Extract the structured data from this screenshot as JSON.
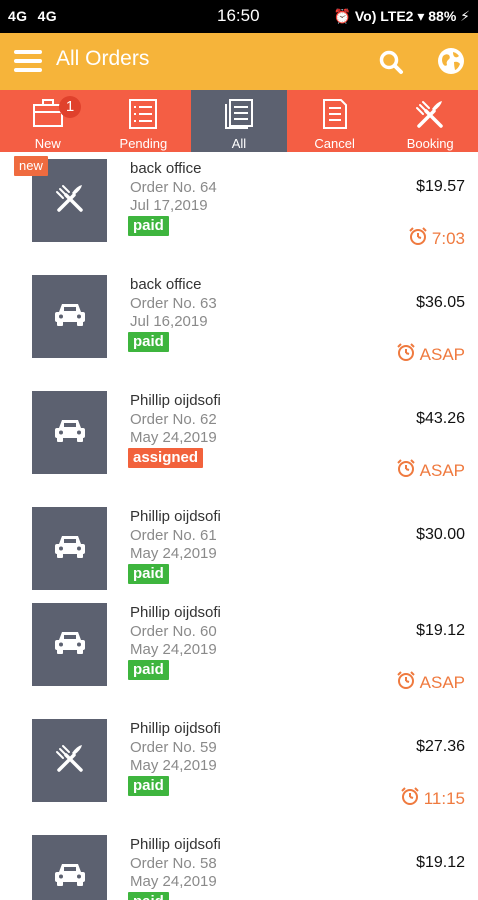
{
  "statusbar": {
    "left": "4G   4G ",
    "time": "16:50",
    "right": "⏰ Vo) LTE2 ▾ 88% ⚡"
  },
  "appbar": {
    "title": "All Orders"
  },
  "tabs": [
    {
      "label": "New",
      "badge": "1",
      "active": false
    },
    {
      "label": "Pending",
      "active": false
    },
    {
      "label": "All",
      "active": true
    },
    {
      "label": "Cancel",
      "active": false
    },
    {
      "label": "Booking",
      "active": false
    }
  ],
  "orders": [
    {
      "name": "back office",
      "order_no": "Order No. 64",
      "date": "Jul 17,2019",
      "status": "paid",
      "price": "$19.57",
      "eta": "7:03",
      "icon": "fork-knife-icon",
      "tag": "new"
    },
    {
      "name": "back office",
      "order_no": "Order No. 63",
      "date": "Jul 16,2019",
      "status": "paid",
      "price": "$36.05",
      "eta": "ASAP",
      "icon": "car-icon"
    },
    {
      "name": "Phillip oijdsofi",
      "order_no": "Order No. 62",
      "date": "May 24,2019",
      "status": "assigned",
      "price": "$43.26",
      "eta": "ASAP",
      "icon": "car-icon"
    },
    {
      "name": "Phillip oijdsofi",
      "order_no": "Order No. 61",
      "date": "May 24,2019",
      "status": "paid",
      "price": "$30.00",
      "eta": "",
      "icon": "car-icon"
    },
    {
      "name": "Phillip oijdsofi",
      "order_no": "Order No. 60",
      "date": "May 24,2019",
      "status": "paid",
      "price": "$19.12",
      "eta": "ASAP",
      "icon": "car-icon"
    },
    {
      "name": "Phillip oijdsofi",
      "order_no": "Order No. 59",
      "date": "May 24,2019",
      "status": "paid",
      "price": "$27.36",
      "eta": "11:15",
      "icon": "fork-knife-icon"
    },
    {
      "name": "Phillip oijdsofi",
      "order_no": "Order No. 58",
      "date": "May 24,2019",
      "status": "paid",
      "price": "$19.12",
      "eta": "",
      "icon": "car-icon"
    }
  ]
}
